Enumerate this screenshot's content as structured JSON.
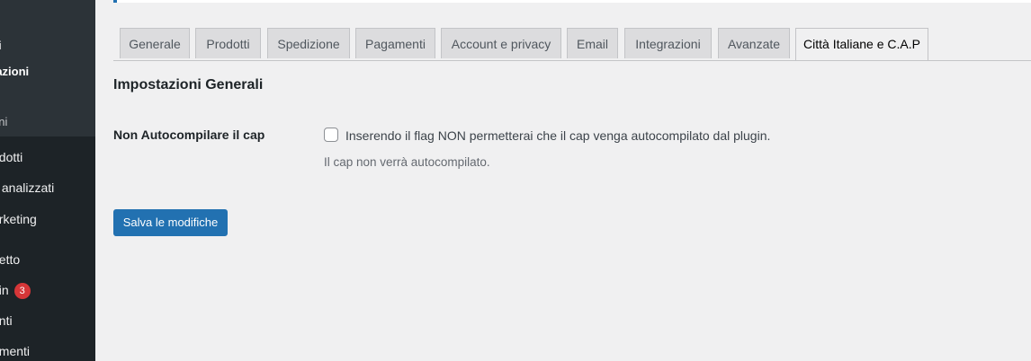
{
  "sidebar": {
    "items": [
      {
        "label": "rti"
      },
      {
        "label": "tazioni"
      },
      {
        "label": "oni"
      },
      {
        "label": "odotti"
      },
      {
        "label": "ti analizzati"
      },
      {
        "label": "arketing"
      },
      {
        "label": "petto"
      },
      {
        "label": "gin",
        "badge": "3"
      },
      {
        "label": "enti"
      },
      {
        "label": "umenti"
      }
    ]
  },
  "tabs": [
    {
      "label": "Generale"
    },
    {
      "label": "Prodotti"
    },
    {
      "label": "Spedizione"
    },
    {
      "label": "Pagamenti"
    },
    {
      "label": "Account e privacy"
    },
    {
      "label": "Email"
    },
    {
      "label": "Integrazioni"
    },
    {
      "label": "Avanzate"
    },
    {
      "label": "Città Italiane e C.A.P"
    }
  ],
  "main": {
    "section_title": "Impostazioni Generali",
    "setting_label": "Non Autocompilare il cap",
    "checkbox_text": "Inserendo il flag NON permetterai che il cap venga autocompilato dal plugin.",
    "description": "Il cap non verrà autocompilato.",
    "checkbox_checked": false,
    "save_label": "Salva le modifiche"
  },
  "colors": {
    "accent": "#2271b1",
    "sidebar_bg": "#1d2327",
    "badge": "#d63638"
  }
}
